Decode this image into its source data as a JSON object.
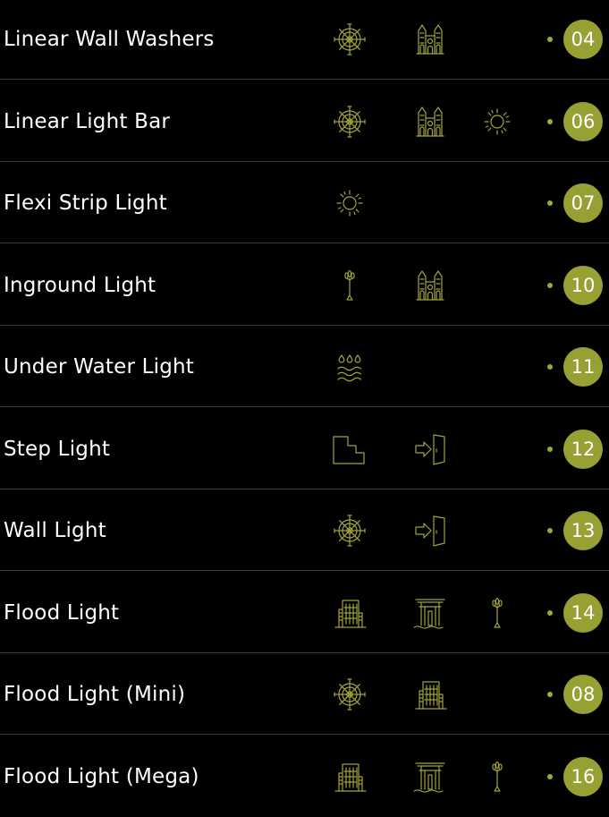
{
  "accent_color": "#97a133",
  "rows": [
    {
      "name": "Linear Wall Washers",
      "icons": [
        "ship-wheel-icon",
        "cathedral-icon"
      ],
      "page": "04"
    },
    {
      "name": "Linear Light Bar",
      "icons": [
        "ship-wheel-icon",
        "cathedral-icon",
        "sun-icon"
      ],
      "page": "06"
    },
    {
      "name": "Flexi Strip Light",
      "icons": [
        "sun-icon"
      ],
      "page": "07"
    },
    {
      "name": "Inground Light",
      "icons": [
        "palm-tree-icon",
        "cathedral-icon"
      ],
      "page": "10"
    },
    {
      "name": "Under Water Light",
      "icons": [
        "water-icon"
      ],
      "page": "11"
    },
    {
      "name": "Step Light",
      "icons": [
        "stairs-icon",
        "door-enter-icon"
      ],
      "page": "12"
    },
    {
      "name": "Wall Light",
      "icons": [
        "ship-wheel-icon",
        "door-enter-icon"
      ],
      "page": "13"
    },
    {
      "name": "Flood Light",
      "icons": [
        "building-icon",
        "torii-gate-icon",
        "palm-tree-icon"
      ],
      "page": "14"
    },
    {
      "name": "Flood Light (Mini)",
      "icons": [
        "ship-wheel-icon",
        "building-icon"
      ],
      "page": "08"
    },
    {
      "name": "Flood Light (Mega)",
      "icons": [
        "building-icon",
        "torii-gate-icon",
        "palm-tree-icon"
      ],
      "page": "16"
    }
  ]
}
